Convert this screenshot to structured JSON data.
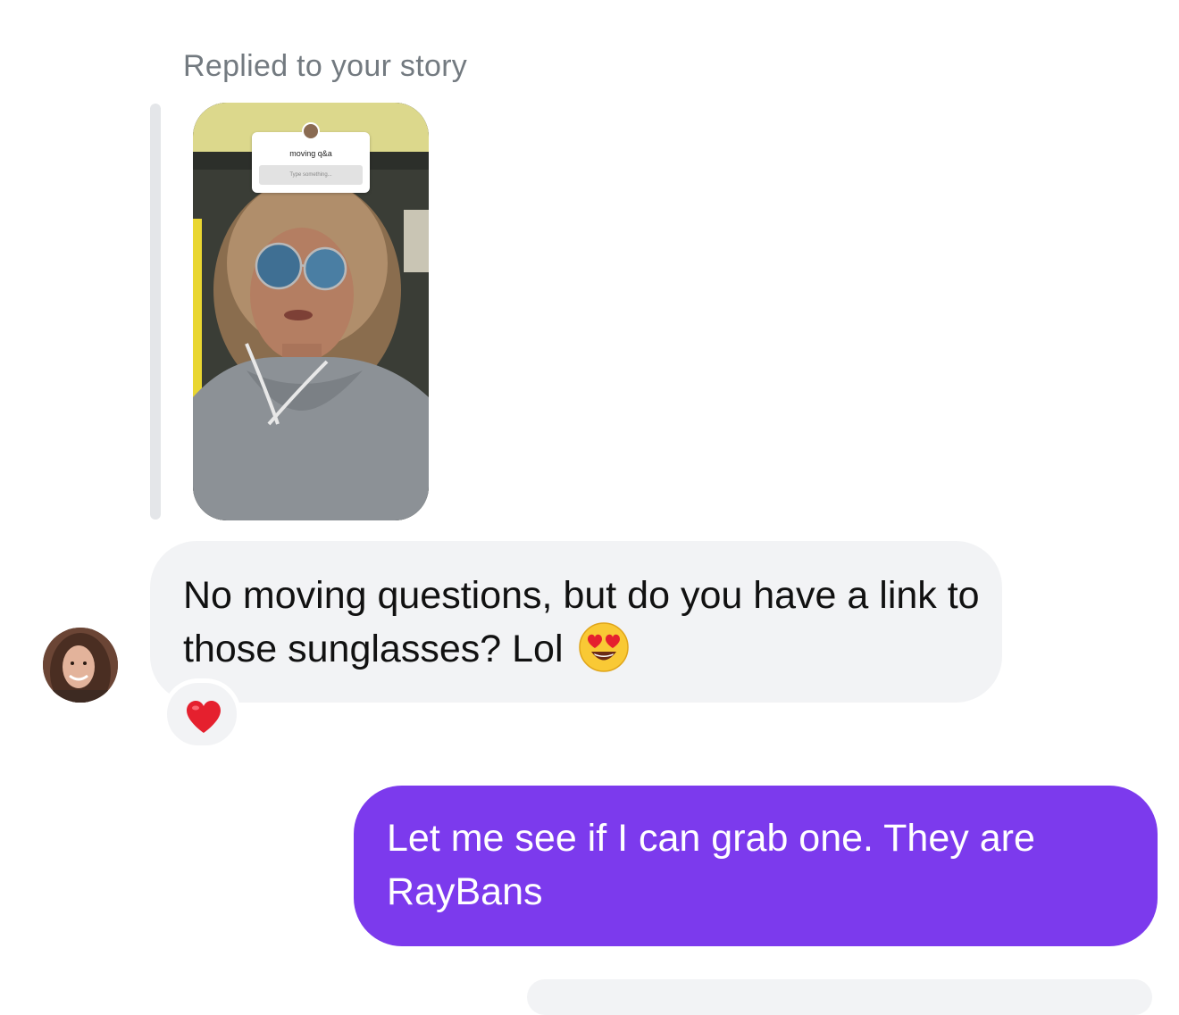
{
  "thread": {
    "reply_label": "Replied to your story",
    "story": {
      "sticker_title": "moving q&a",
      "sticker_placeholder": "Type something..."
    },
    "incoming_message": {
      "text": "No moving questions, but do you have a link to those sunglasses? Lol",
      "emoji": "smiling-face-with-heart-eyes",
      "reaction": "red-heart"
    },
    "outgoing_message": {
      "text": "Let me see if I can grab one. They are RayBans"
    }
  },
  "colors": {
    "outgoing_bubble": "#7c3aed",
    "incoming_bubble": "#f2f3f5",
    "reply_label": "#737a80",
    "reaction_heart": "#e5202e"
  }
}
